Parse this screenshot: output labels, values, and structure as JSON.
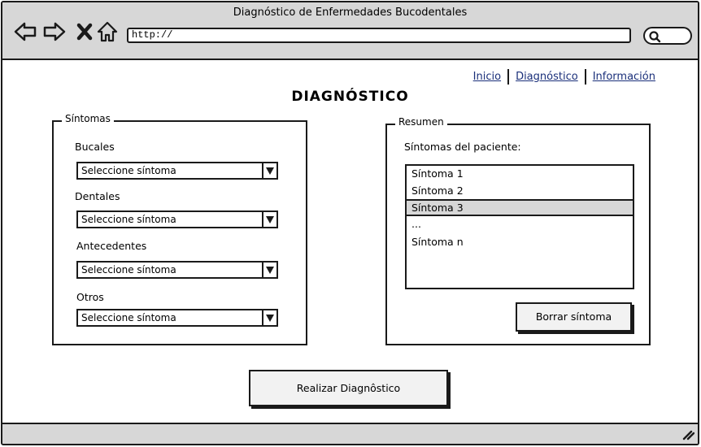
{
  "window": {
    "title": "Diagnóstico de Enfermedades Bucodentales"
  },
  "browser": {
    "url": "http://",
    "icons": [
      "back-arrow-icon",
      "forward-arrow-icon",
      "close-x-icon",
      "home-icon",
      "search-icon"
    ]
  },
  "nav": {
    "links": [
      {
        "label": "Inicio"
      },
      {
        "label": "Diagnóstico"
      },
      {
        "label": "Información"
      }
    ]
  },
  "page": {
    "title": "DIAGNÓSTICO"
  },
  "sintomas": {
    "legend": "Síntomas",
    "groups": [
      {
        "label": "Bucales",
        "selected": "Seleccione síntoma"
      },
      {
        "label": "Dentales",
        "selected": "Seleccione síntoma"
      },
      {
        "label": "Antecedentes",
        "selected": "Seleccione síntoma"
      },
      {
        "label": "Otros",
        "selected": "Seleccione síntoma"
      }
    ]
  },
  "resumen": {
    "legend": "Resumen",
    "list_label": "Síntomas del paciente:",
    "items": [
      "Síntoma 1",
      "Síntoma 2",
      "Síntoma 3",
      "...",
      "Síntoma n"
    ],
    "selected_index": 2,
    "delete_button": "Borrar síntoma"
  },
  "actions": {
    "diagnose_button": "Realizar Diagnôstico"
  },
  "colors": {
    "chrome": "#d7d7d7",
    "border": "#1a1a1a",
    "link": "#1a2f7a"
  }
}
